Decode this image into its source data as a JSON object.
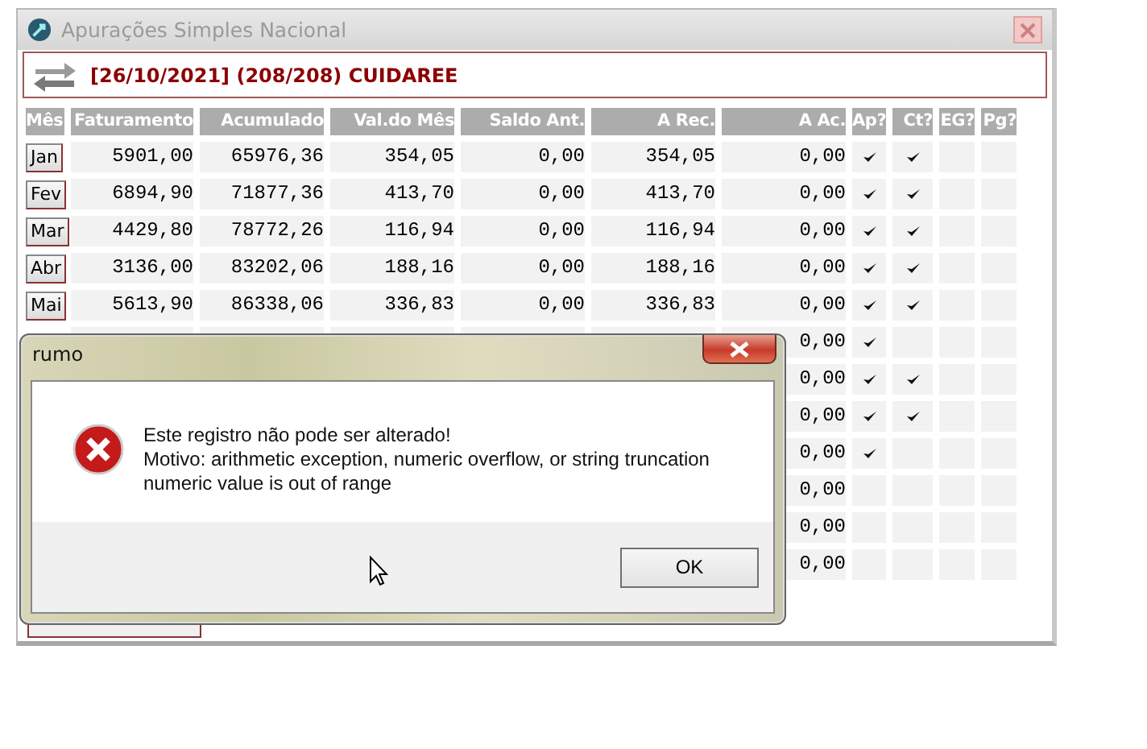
{
  "window": {
    "title": "Apurações Simples Nacional"
  },
  "header": {
    "text": "[26/10/2021] (208/208) CUIDAREE"
  },
  "table": {
    "columns": [
      "Mês",
      "Faturamento",
      "Acumulado",
      "Val.do Mês",
      "Saldo Ant.",
      "A Rec.",
      "A Ac.",
      "Ap?",
      "Ct?",
      "EG?",
      "Pg?"
    ],
    "rows": [
      {
        "mes": "Jan",
        "faturamento": "5901,00",
        "acumulado": "65976,36",
        "val_mes": "354,05",
        "saldo_ant": "0,00",
        "a_rec": "354,05",
        "a_ac": "0,00",
        "ap": true,
        "ct": true,
        "eg": false,
        "pg": false
      },
      {
        "mes": "Fev",
        "faturamento": "6894,90",
        "acumulado": "71877,36",
        "val_mes": "413,70",
        "saldo_ant": "0,00",
        "a_rec": "413,70",
        "a_ac": "0,00",
        "ap": true,
        "ct": true,
        "eg": false,
        "pg": false
      },
      {
        "mes": "Mar",
        "faturamento": "4429,80",
        "acumulado": "78772,26",
        "val_mes": "116,94",
        "saldo_ant": "0,00",
        "a_rec": "116,94",
        "a_ac": "0,00",
        "ap": true,
        "ct": true,
        "eg": false,
        "pg": false
      },
      {
        "mes": "Abr",
        "faturamento": "3136,00",
        "acumulado": "83202,06",
        "val_mes": "188,16",
        "saldo_ant": "0,00",
        "a_rec": "188,16",
        "a_ac": "0,00",
        "ap": true,
        "ct": true,
        "eg": false,
        "pg": false
      },
      {
        "mes": "Mai",
        "faturamento": "5613,90",
        "acumulado": "86338,06",
        "val_mes": "336,83",
        "saldo_ant": "0,00",
        "a_rec": "336,83",
        "a_ac": "0,00",
        "ap": true,
        "ct": true,
        "eg": false,
        "pg": false
      },
      {
        "a_ac": "0,00",
        "ap": true,
        "ct": false,
        "eg": false,
        "pg": false
      },
      {
        "a_ac": "0,00",
        "ap": true,
        "ct": true,
        "eg": false,
        "pg": false
      },
      {
        "a_ac": "0,00",
        "ap": true,
        "ct": true,
        "eg": false,
        "pg": false
      },
      {
        "a_ac": "0,00",
        "ap": true,
        "ct": false,
        "eg": false,
        "pg": false
      },
      {
        "a_ac": "0,00",
        "ap": false,
        "ct": false,
        "eg": false,
        "pg": false
      },
      {
        "a_ac": "0,00",
        "ap": false,
        "ct": false,
        "eg": false,
        "pg": false
      },
      {
        "a_ac": "0,00",
        "ap": false,
        "ct": false,
        "eg": false,
        "pg": false
      }
    ]
  },
  "dialog": {
    "title": "rumo",
    "lines": [
      "Este registro não pode ser alterado!",
      "Motivo: arithmetic exception, numeric overflow, or string truncation",
      "numeric value is out of range"
    ],
    "button": "OK"
  }
}
